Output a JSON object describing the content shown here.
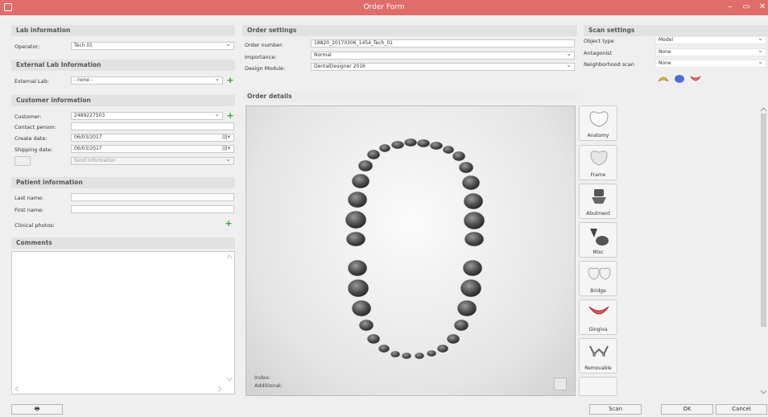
{
  "window": {
    "title": "Order Form"
  },
  "lab_info": {
    "header": "Lab information",
    "operator_label": "Operator:",
    "operator_value": "Tech 01"
  },
  "external_lab": {
    "header": "External Lab Information",
    "label": "External Lab:",
    "value": "- none -"
  },
  "customer": {
    "header": "Customer information",
    "customer_label": "Customer:",
    "customer_value": "2489227503",
    "contact_label": "Contact person:",
    "contact_value": "",
    "create_label": "Create date:",
    "create_value": "06/03/2017",
    "shipping_label": "Shipping date:",
    "shipping_value": "06/03/2017",
    "send_value": "Send information"
  },
  "patient": {
    "header": "Patient information",
    "last_label": "Last name:",
    "first_label": "First name:",
    "photos_label": "Clinical photos:"
  },
  "comments": {
    "header": "Comments"
  },
  "order_settings": {
    "header": "Order settings",
    "number_label": "Order number:",
    "number_value": "18820_20170306_1454_Tech_01",
    "importance_label": "Importance:",
    "importance_value": "Normal",
    "design_label": "Design Module:",
    "design_value": "DentalDesigner 2016"
  },
  "scan_settings": {
    "header": "Scan settings",
    "object_label": "Object type",
    "object_value": "Model",
    "antagonist_label": "Antagonist",
    "antagonist_value": "None",
    "neighborhood_label": "Neighborhood scan",
    "neighborhood_value": "None"
  },
  "order_details": {
    "header": "Order details",
    "index_label": "Index:",
    "additional_label": "Additional:"
  },
  "tools": [
    "Anatomy",
    "Frame",
    "Abutment",
    "Misc",
    "Bridge",
    "Gingiva",
    "Removable"
  ],
  "buttons": {
    "scan": "Scan",
    "ok": "OK",
    "cancel": "Cancel"
  },
  "colors": {
    "titlebar": "#e06c6c",
    "add": "#3a9b3a"
  }
}
